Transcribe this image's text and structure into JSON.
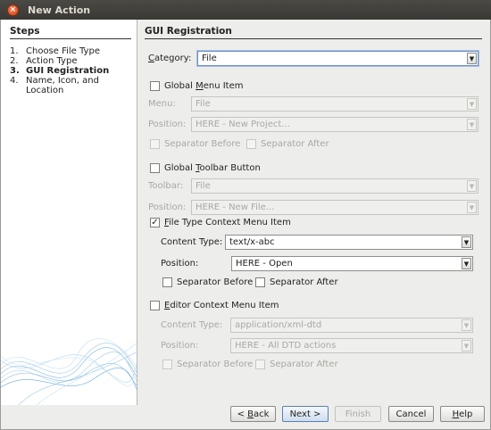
{
  "window": {
    "title": "New Action"
  },
  "steps": {
    "title": "Steps",
    "items": [
      {
        "num": "1.",
        "label": "Choose File Type"
      },
      {
        "num": "2.",
        "label": "Action Type"
      },
      {
        "num": "3.",
        "label": "GUI Registration"
      },
      {
        "num": "4.",
        "label": "Name, Icon, and Location"
      }
    ]
  },
  "panel": {
    "title": "GUI Registration",
    "category": {
      "label": "Category:",
      "value": "File"
    },
    "global_menu": {
      "checkbox_label": "Global Menu Item",
      "checked": false,
      "menu_label": "Menu:",
      "menu_value": "File",
      "position_label": "Position:",
      "position_value": "HERE - New Project...",
      "sep_before": "Separator Before",
      "sep_after": "Separator After"
    },
    "global_toolbar": {
      "checkbox_label": "Global Toolbar Button",
      "checked": false,
      "toolbar_label": "Toolbar:",
      "toolbar_value": "File",
      "position_label": "Position:",
      "position_value": "HERE - New File..."
    },
    "file_type_context": {
      "checkbox_label": "File Type Context Menu Item",
      "checked": true,
      "content_type_label": "Content Type:",
      "content_type_value": "text/x-abc",
      "position_label": "Position:",
      "position_value": "HERE - Open",
      "sep_before": "Separator Before",
      "sep_after": "Separator After"
    },
    "editor_context": {
      "checkbox_label": "Editor Context Menu Item",
      "checked": false,
      "content_type_label": "Content Type:",
      "content_type_value": "application/xml-dtd",
      "position_label": "Position:",
      "position_value": "HERE - All DTD actions",
      "sep_before": "Separator Before",
      "sep_after": "Separator After"
    }
  },
  "buttons": {
    "back": "< Back",
    "next": "Next >",
    "finish": "Finish",
    "cancel": "Cancel",
    "help": "Help"
  },
  "icons": {
    "close": "close-icon",
    "check": "checkmark-icon",
    "arrow": "chevron-down-icon"
  }
}
